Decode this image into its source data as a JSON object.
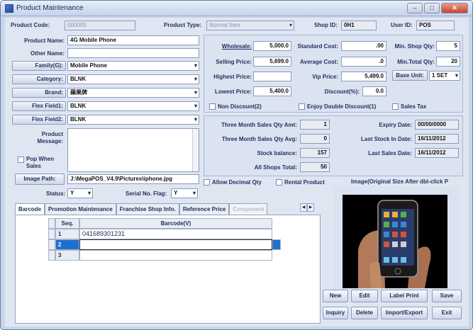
{
  "window": {
    "title": "Product Maintenance"
  },
  "header": {
    "product_code_label": "Product Code:",
    "product_code_value": "000005",
    "product_type_label": "Product Type:",
    "product_type_value": "Normal Item",
    "shop_id_label": "Shop ID:",
    "shop_id_value": "0H1",
    "user_id_label": "User ID:",
    "user_id_value": "POS"
  },
  "left": {
    "product_name_label": "Product Name:",
    "product_name_value": "4G Mobile Phone",
    "other_name_label": "Other Name:",
    "other_name_value": "",
    "family_label": "Family(G):",
    "family_value": "Mobile Phone",
    "category_label": "Category:",
    "category_value": "BLNK",
    "brand_label": "Brand:",
    "brand_value": "蘋果牌",
    "flex1_label": "Flex Field1:",
    "flex1_value": "BLNK",
    "flex2_label": "Flex Field2:",
    "flex2_value": "BLNK",
    "product_message_label": "Product Message:",
    "product_message_value": "",
    "pop_when_sales_label": "Pop When Sales",
    "image_path_button": "Image Path:",
    "image_path_value": "J:\\MegaPOS_V4.9\\Pictures\\iphone.jpg",
    "status_label": "Status:",
    "status_value": "Y",
    "serial_flag_label": "Serial No. Flag:",
    "serial_flag_value": "Y"
  },
  "pricing": {
    "wholesale_label": "Wholesale:",
    "wholesale_value": "5,000.0",
    "selling_label": "Selling Price:",
    "selling_value": "5,699.0",
    "highest_label": "Highest Price:",
    "highest_value": "",
    "lowest_label": "Lowest Price:",
    "lowest_value": "5,400.0",
    "standard_cost_label": "Standard Cost:",
    "standard_cost_value": ".00",
    "average_cost_label": "Average Cost:",
    "average_cost_value": ".0",
    "vip_label": "Vip Price:",
    "vip_value": "5,499.0",
    "discount_label": "Discount(%):",
    "discount_value": "0.0",
    "min_shop_qty_label": "Min. Shop Qty:",
    "min_shop_qty_value": "5",
    "min_total_qty_label": "Min.Total Qty:",
    "min_total_qty_value": "20",
    "base_unit_button": "Base Unit:",
    "base_unit_value": "1 SET",
    "non_discount_label": "Non Discount(2)",
    "enjoy_double_label": "Enjoy Double Discount(1)",
    "sales_tax_label": "Sales Tax"
  },
  "stats": {
    "three_month_amt_label": "Three Month Sales Qty Amt:",
    "three_month_amt_value": "1",
    "three_month_avg_label": "Three Month Sales Qty Avg:",
    "three_month_avg_value": "0",
    "stock_balance_label": "Stock balance:",
    "stock_balance_value": "157",
    "all_shops_label": "All Shops Total:",
    "all_shops_value": "50",
    "expiry_label": "Expiry Date:",
    "expiry_value": "00/00/0000",
    "last_stock_label": "Last Stock In Date:",
    "last_stock_value": "16/11/2012",
    "last_sales_label": "Last Sales Date:",
    "last_sales_value": "16/11/2012"
  },
  "options": {
    "allow_decimal_label": "Allow Decimal Qty",
    "rental_label": "Rental Product"
  },
  "image": {
    "caption": "Image(Original Size After dbl-click P"
  },
  "tabs": [
    "Barcode",
    "Promotion Maintenance",
    "Franchise Shop Info.",
    "Reference Price",
    "Component"
  ],
  "grid": {
    "headers": [
      "Seq.",
      "Barcode(V)"
    ],
    "rows": [
      {
        "seq": "1",
        "barcode": "041689301231"
      },
      {
        "seq": "2",
        "barcode": ""
      },
      {
        "seq": "3",
        "barcode": ""
      }
    ]
  },
  "actions": {
    "new": "New",
    "edit": "Edit",
    "label_print": "Label Print",
    "save": "Save",
    "inquiry": "Inquiry",
    "delete": "Delete",
    "import_export": "Import/Export",
    "exit": "Exit"
  },
  "colors": {
    "accent": "#1f6fd1",
    "window_bg": "#dfe6f2"
  }
}
